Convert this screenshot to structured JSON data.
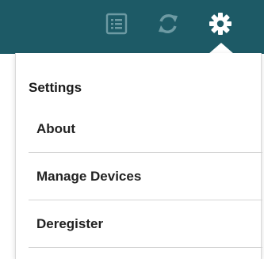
{
  "toolbar": {
    "background_color": "#1d5a66",
    "icons": [
      "list-icon",
      "sync-icon",
      "gear-icon"
    ],
    "icon_color_dim": "#6d9aa3",
    "icon_color_active": "#ffffff"
  },
  "menu": {
    "header": "Settings",
    "items": [
      {
        "label": "About"
      },
      {
        "label": "Manage Devices"
      },
      {
        "label": "Deregister"
      }
    ]
  }
}
